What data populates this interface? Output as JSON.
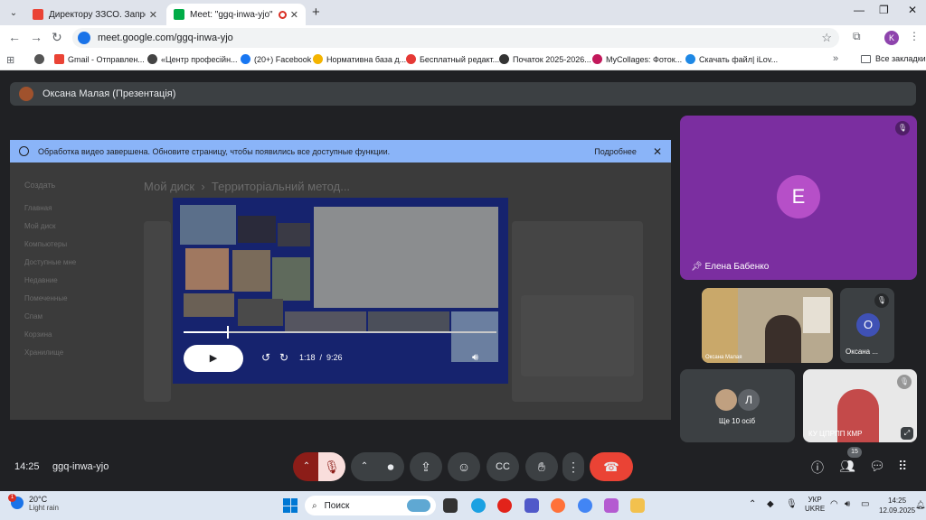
{
  "browser": {
    "tabs": [
      {
        "title": "Директору ЗЗСО. Запрошення",
        "active": false
      },
      {
        "title": "Meet: \"ggq-inwa-yjo\"",
        "active": true
      }
    ],
    "url": "meet.google.com/ggq-inwa-yjo",
    "profile_initial": "K",
    "bookmarks": [
      "Gmail - Отправлен...",
      "«Центр професійн...",
      "(20+) Facebook",
      "Нормативна база д...",
      "Бесплатный редакт...",
      "Початок 2025-2026...",
      "MyCollages: Фоток...",
      "Скачать файл| iLov..."
    ],
    "all_bookmarks": "Все закладки"
  },
  "meet": {
    "presenter": "Оксана Малая (Презентація)",
    "notice": {
      "message": "Обработка видео завершена. Обновите страницу, чтобы появились все доступные функции.",
      "more": "Подробнее"
    },
    "drive": {
      "title_left": "Мой диск",
      "title_right": "Территоріальний метод...",
      "create": "Создать",
      "menu": [
        "Главная",
        "Мой диск",
        "Компьютеры",
        "Доступные мне",
        "Недавние",
        "Помеченные",
        "Спам",
        "Корзина",
        "Хранилище"
      ]
    },
    "video": {
      "current_time": "1:18",
      "duration": "9:26",
      "progress": 0.138
    },
    "participants": {
      "featured": {
        "name": "Елена Бабенко",
        "initial": "Е",
        "color": "#b64fc8"
      },
      "cam1": {
        "name": "Оксана Малая"
      },
      "tile_o": {
        "name": "Оксана ...",
        "initial": "О",
        "color": "#3f51b5"
      },
      "others": {
        "label": "Ще 10 осіб",
        "initial": "Л"
      },
      "cam2": {
        "name": "КУ ЦПРПП КМР"
      }
    },
    "footer": {
      "time": "14:25",
      "code": "ggq-inwa-yjo",
      "people_count": "15"
    }
  },
  "taskbar": {
    "temperature": "20°C",
    "weather": "Light rain",
    "weather_badge": "1",
    "search": "Поиск",
    "lang1": "УКР",
    "lang2": "UKRE",
    "time": "14:25",
    "date": "12.09.2025"
  }
}
